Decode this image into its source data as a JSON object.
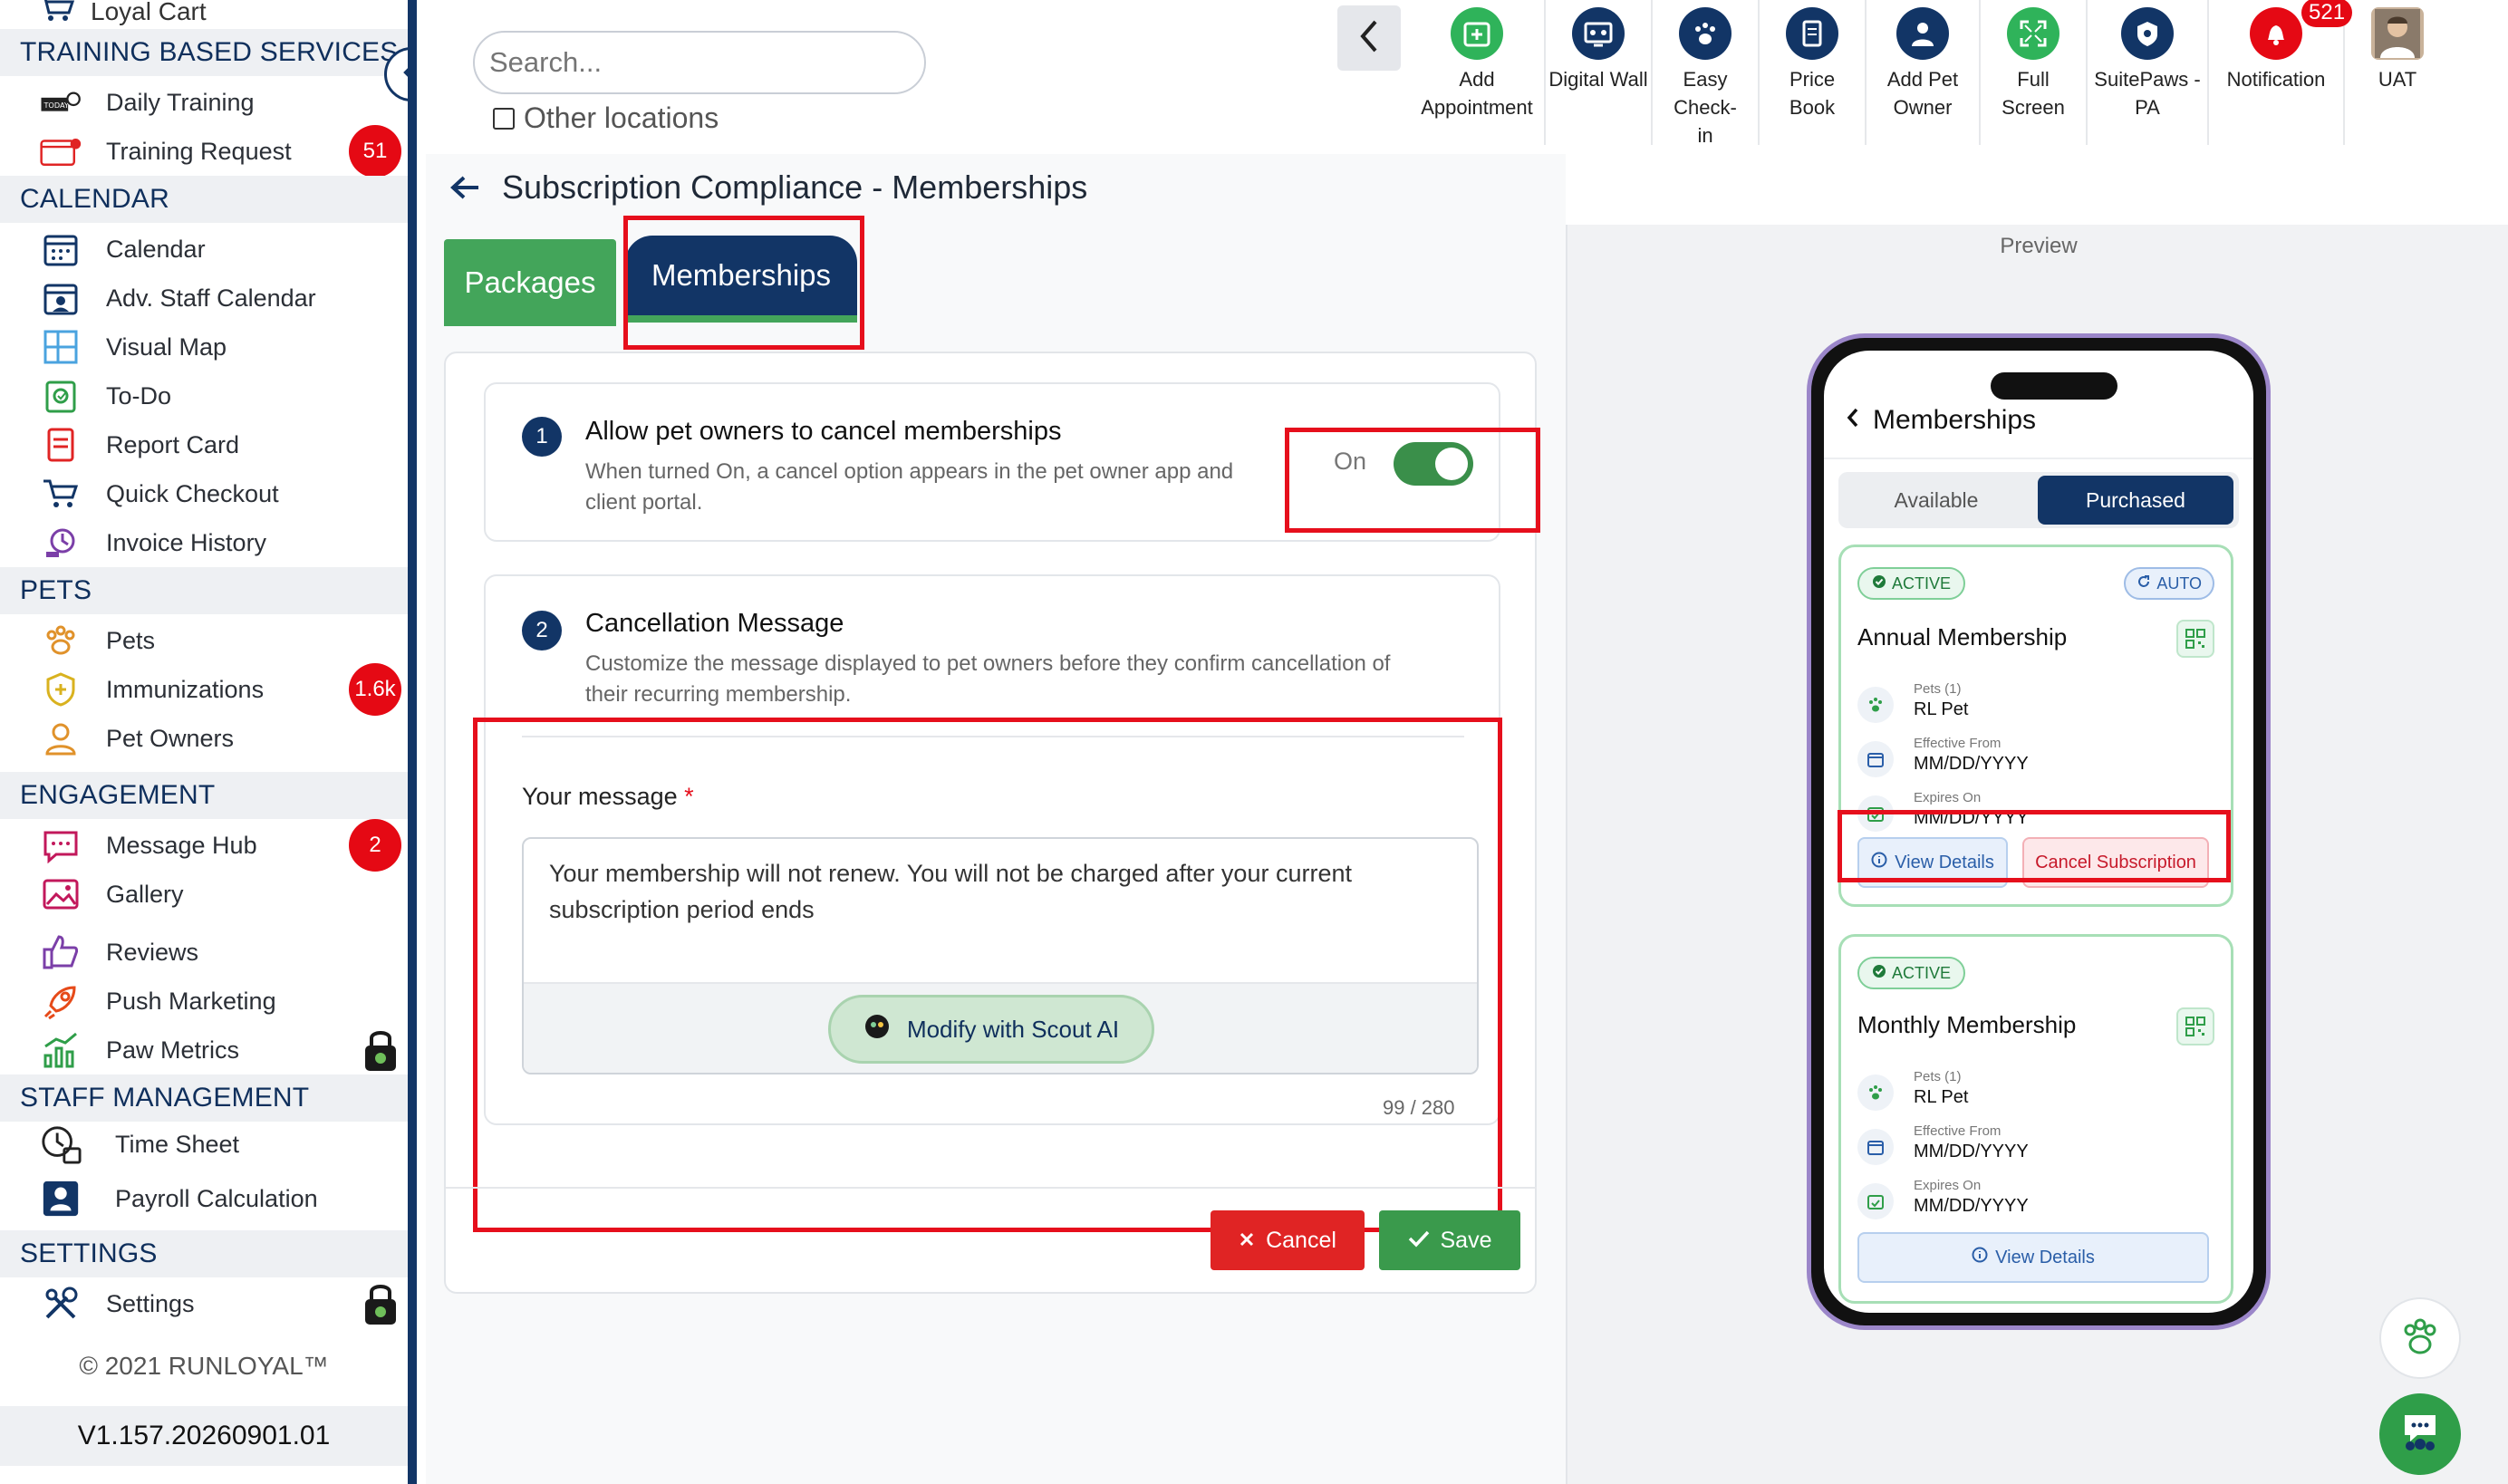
{
  "sidebar": {
    "top_cut": "Loyal Cart",
    "sections": [
      {
        "title": "TRAINING BASED SERVICES"
      },
      {
        "title": "CALENDAR"
      },
      {
        "title": "PETS"
      },
      {
        "title": "ENGAGEMENT"
      },
      {
        "title": "STAFF MANAGEMENT"
      },
      {
        "title": "SETTINGS"
      }
    ],
    "items": [
      {
        "label": "Daily Training",
        "icon": "daily-training-icon"
      },
      {
        "label": "Training Request",
        "icon": "training-request-icon",
        "badge": "51"
      },
      {
        "label": "Calendar",
        "icon": "calendar-icon"
      },
      {
        "label": "Adv. Staff Calendar",
        "icon": "staff-calendar-icon"
      },
      {
        "label": "Visual Map",
        "icon": "map-icon"
      },
      {
        "label": "To-Do",
        "icon": "todo-icon"
      },
      {
        "label": "Report Card",
        "icon": "report-card-icon"
      },
      {
        "label": "Quick Checkout",
        "icon": "cart-icon"
      },
      {
        "label": "Invoice History",
        "icon": "invoice-icon"
      },
      {
        "label": "Pets",
        "icon": "paw-icon"
      },
      {
        "label": "Immunizations",
        "icon": "shield-icon",
        "badge": "1.6k"
      },
      {
        "label": "Pet Owners",
        "icon": "person-icon"
      },
      {
        "label": "Message Hub",
        "icon": "chat-icon",
        "badge": "2"
      },
      {
        "label": "Gallery",
        "icon": "image-icon"
      },
      {
        "label": "Reviews",
        "icon": "thumbs-up-icon"
      },
      {
        "label": "Push Marketing",
        "icon": "rocket-icon"
      },
      {
        "label": "Paw Metrics",
        "icon": "chart-icon",
        "locked": true
      },
      {
        "label": "Time Sheet",
        "icon": "clock-icon"
      },
      {
        "label": "Payroll Calculation",
        "icon": "payroll-icon"
      },
      {
        "label": "Settings",
        "icon": "tools-icon",
        "locked": true
      }
    ],
    "copyright": "© 2021  RUNLOYAL™",
    "version": "V1.157.20260901.01"
  },
  "topbar": {
    "search_placeholder": "Search...",
    "other_locations": "Other locations",
    "tools": [
      {
        "label": "Add Appointment",
        "icon": "calendar-plus-icon",
        "color": "#2fb35a"
      },
      {
        "label": "Digital Wall",
        "icon": "digital-wall-icon",
        "color": "#123566"
      },
      {
        "label": "Easy Check-in",
        "icon": "paw-icon",
        "color": "#123566"
      },
      {
        "label": "Price Book",
        "icon": "book-icon",
        "color": "#123566"
      },
      {
        "label": "Add Pet Owner",
        "icon": "user-plus-icon",
        "color": "#123566"
      },
      {
        "label": "Full Screen",
        "icon": "fullscreen-icon",
        "color": "#2fb35a"
      },
      {
        "label": "SuitePaws - PA",
        "icon": "suitepaws-icon",
        "color": "#123566"
      },
      {
        "label": "Notification",
        "icon": "bell-icon",
        "color": "#e50914",
        "badge": "521"
      },
      {
        "label": "UAT",
        "icon": "avatar-icon"
      }
    ]
  },
  "main": {
    "title": "Subscription Compliance - Memberships",
    "tabs": [
      {
        "label": "Packages"
      },
      {
        "label": "Memberships",
        "active": true
      }
    ],
    "setting1": {
      "number": "1",
      "title": "Allow pet owners to cancel memberships",
      "desc": "When turned On, a cancel option appears in the pet owner app and client portal.",
      "toggle_label": "On",
      "toggle_on": true
    },
    "setting2": {
      "number": "2",
      "title": "Cancellation Message",
      "desc": "Customize the message displayed to pet owners before they confirm cancellation of their recurring membership.",
      "message_label": "Your message",
      "required_mark": "*",
      "message": "Your membership will not renew. You will not be charged after your current subscription period ends",
      "scout_button": "Modify with Scout AI",
      "counter": "99 / 280"
    },
    "cancel_button": "Cancel",
    "save_button": "Save"
  },
  "preview": {
    "label": "Preview",
    "header": "Memberships",
    "tabs": [
      "Available",
      "Purchased"
    ],
    "cards": [
      {
        "status": "ACTIVE",
        "auto": "AUTO",
        "title": "Annual Membership",
        "pets_label": "Pets (1)",
        "pets_value": "RL Pet",
        "effective_label": "Effective From",
        "effective_value": "MM/DD/YYYY",
        "expires_label": "Expires On",
        "expires_value": "MM/DD/YYYY",
        "view_details": "View Details",
        "cancel_subscription": "Cancel Subscription"
      },
      {
        "status": "ACTIVE",
        "title": "Monthly Membership",
        "pets_label": "Pets (1)",
        "pets_value": "RL Pet",
        "effective_label": "Effective From",
        "effective_value": "MM/DD/YYYY",
        "expires_label": "Expires On",
        "expires_value": "MM/DD/YYYY",
        "view_details": "View Details"
      }
    ]
  },
  "colors": {
    "navy": "#123566",
    "green": "#43a55a",
    "red": "#e60f1c",
    "highlight": "#e60f1c"
  }
}
